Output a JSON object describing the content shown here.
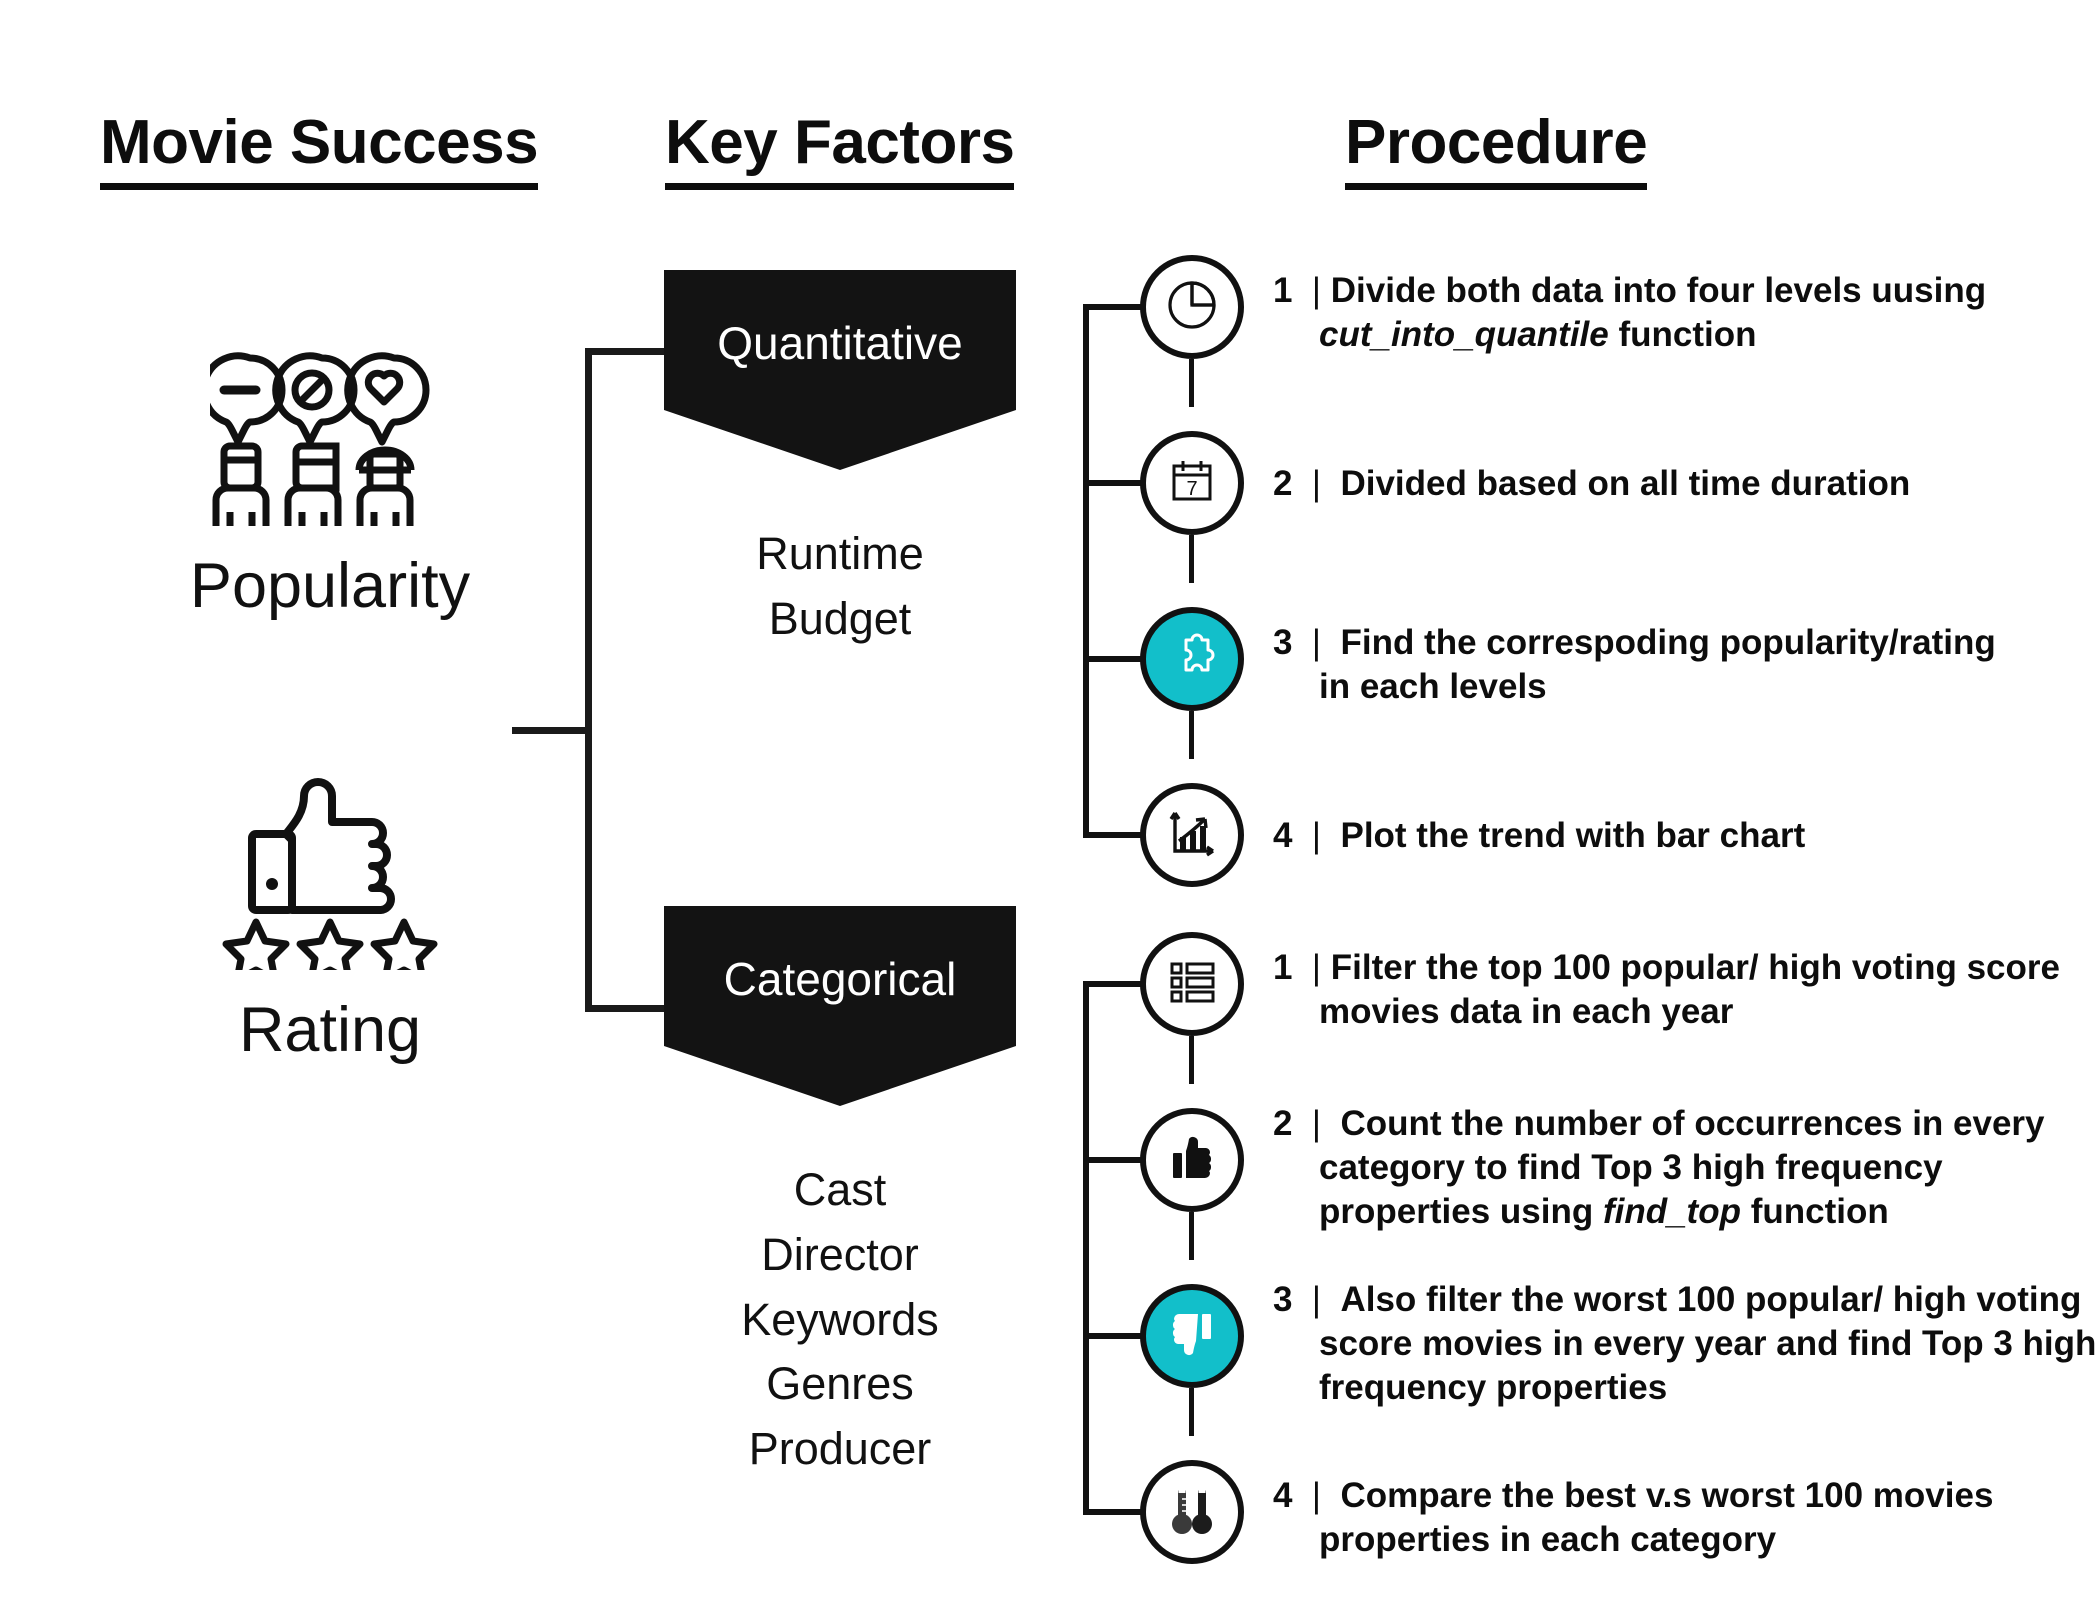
{
  "headings": {
    "movie_success": "Movie Success",
    "key_factors": "Key Factors",
    "procedure": "Procedure"
  },
  "left_column": {
    "popularity": {
      "label": "Popularity",
      "icon": "people-with-opinion-pins-icon"
    },
    "rating": {
      "label": "Rating",
      "icon": "thumbs-up-with-three-stars-icon"
    }
  },
  "key_factors": {
    "quantitative": {
      "banner_label": "Quantitative",
      "items": [
        "Runtime",
        "Budget"
      ]
    },
    "categorical": {
      "banner_label": "Categorical",
      "items": [
        "Cast",
        "Director",
        "Keywords",
        "Genres",
        "Producer"
      ]
    }
  },
  "procedure": {
    "quantitative_steps": [
      {
        "number": "1",
        "icon": "pie-chart-icon",
        "accent": false,
        "line1_pre": "Divide both data into four levels ",
        "line1_tail": "uusing",
        "line2_italic": "cut_into_quantile",
        "line2_post": " function"
      },
      {
        "number": "2",
        "icon": "calendar-7-icon",
        "accent": false,
        "line1_pre": "Divided based on all time duration",
        "line1_tail": "",
        "line2_italic": "",
        "line2_post": ""
      },
      {
        "number": "3",
        "icon": "puzzle-piece-icon",
        "accent": true,
        "line1_pre": "Find the correspoding popularity/rating",
        "line1_tail": "",
        "line2_italic": "",
        "line2_post": "in each levels"
      },
      {
        "number": "4",
        "icon": "bar-chart-trend-icon",
        "accent": false,
        "line1_pre": "Plot the trend with bar chart",
        "line1_tail": "",
        "line2_italic": "",
        "line2_post": ""
      }
    ],
    "categorical_steps": [
      {
        "number": "1",
        "icon": "checklist-icon",
        "accent": false,
        "line1": "Filter the top 100 popular/ high voting score",
        "line2": "movies data in each year",
        "line3": "",
        "line3_italic": "",
        "line3_post": ""
      },
      {
        "number": "2",
        "icon": "thumbs-up-solid-icon",
        "accent": false,
        "line1": "Count the number of occurrences in every",
        "line2": "category to find Top 3 high frequency",
        "line3": "properties using ",
        "line3_italic": "find_top",
        "line3_post": " function"
      },
      {
        "number": "3",
        "icon": "thumbs-down-solid-icon",
        "accent": true,
        "line1": "Also filter the worst 100 popular/ high voting",
        "line2": "score movies in every year and find Top 3 high",
        "line3": "frequency properties",
        "line3_italic": "",
        "line3_post": ""
      },
      {
        "number": "4",
        "icon": "two-thermometers-icon",
        "accent": false,
        "line1": "Compare the best v.s worst 100 movies",
        "line2": "properties in each category",
        "line3": "",
        "line3_italic": "",
        "line3_post": ""
      }
    ]
  },
  "colors": {
    "accent": "#12bfca",
    "ink": "#111111",
    "banner_bg": "#131313",
    "page_bg": "#ffffff"
  }
}
